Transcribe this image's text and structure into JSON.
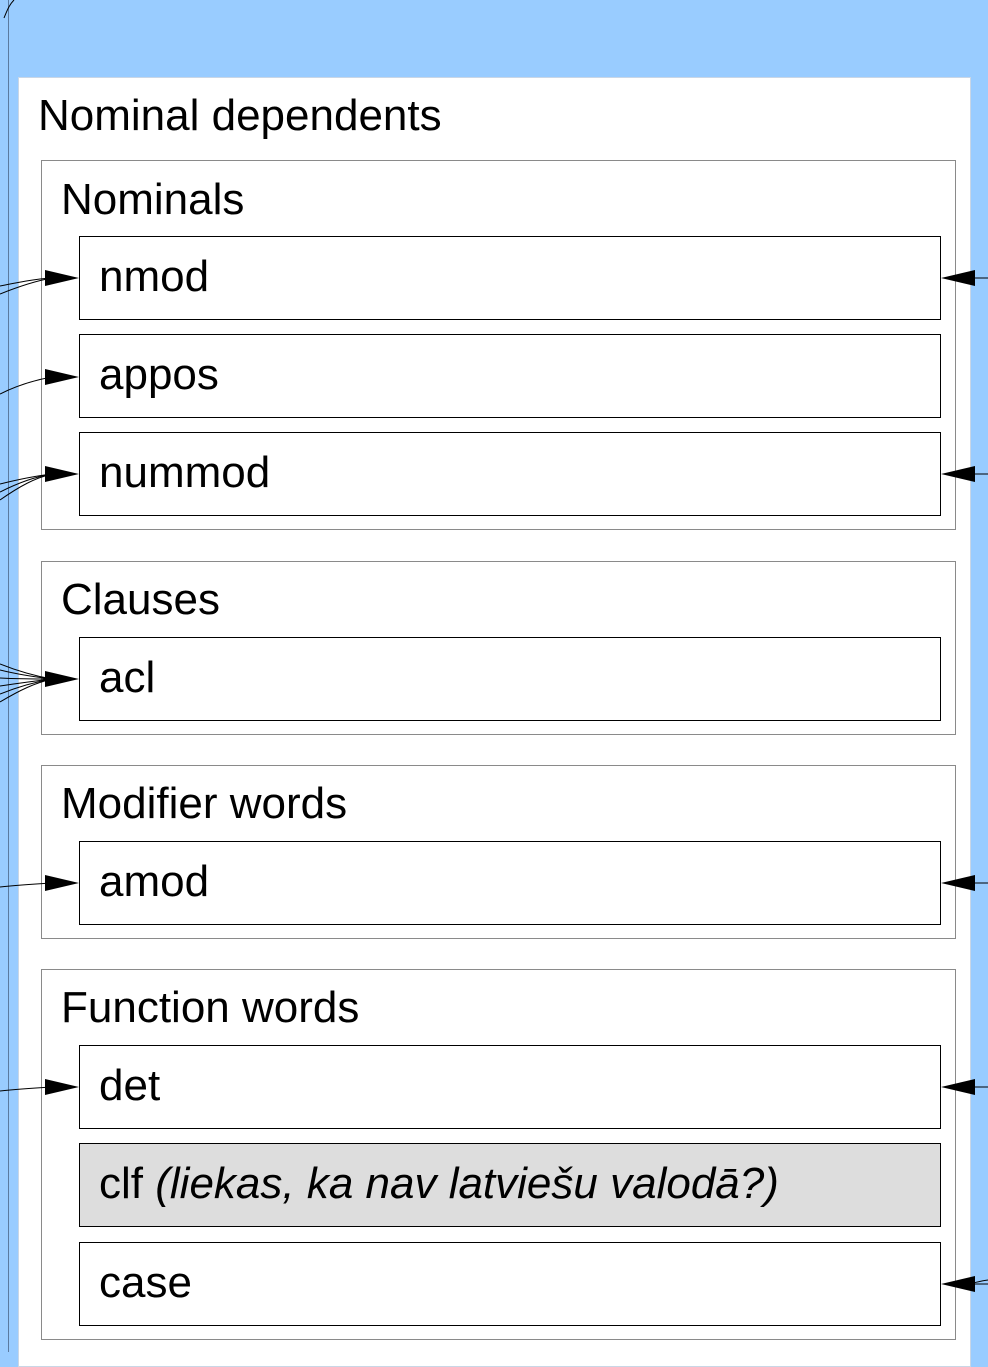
{
  "title": "Nominal dependents",
  "groups": [
    {
      "title": "Nominals",
      "items": [
        {
          "label": "nmod"
        },
        {
          "label": "appos"
        },
        {
          "label": "nummod"
        }
      ]
    },
    {
      "title": "Clauses",
      "items": [
        {
          "label": "acl"
        }
      ]
    },
    {
      "title": "Modifier words",
      "items": [
        {
          "label": "amod"
        }
      ]
    },
    {
      "title": "Function words",
      "items": [
        {
          "label": "det"
        },
        {
          "label": "clf",
          "note": "(liekas, ka nav latviešu valodā?)"
        },
        {
          "label": "case"
        }
      ]
    }
  ],
  "colors": {
    "background": "#99ccff",
    "panel": "#ffffff",
    "disabled_box": "#dddddd",
    "arrow": "#000000"
  }
}
